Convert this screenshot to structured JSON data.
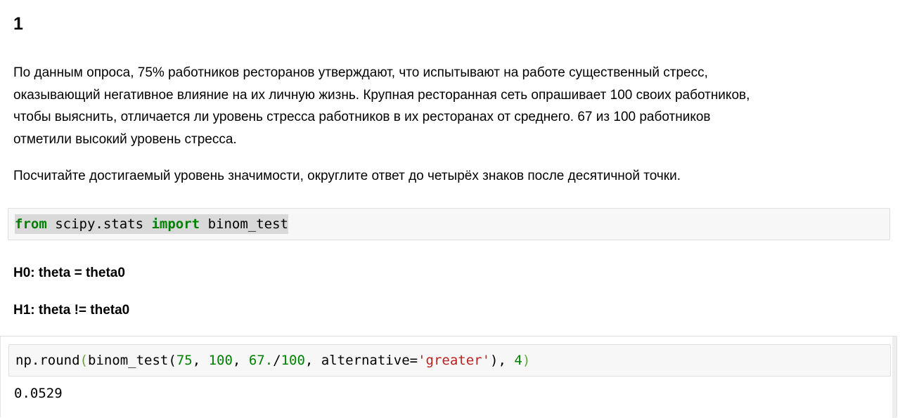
{
  "cell_heading": "1",
  "problem": {
    "lines": [
      "По данным опроса, 75% работников ресторанов утверждают, что испытывают на работе существенный стресс,",
      "оказывающий негативное влияние на их личную жизнь. Крупная ресторанная сеть опрашивает 100 своих работников,",
      "чтобы выяснить, отличается ли уровень стресса работников в их ресторанах от среднего. 67 из 100 работников",
      "отметили высокий уровень стресса."
    ],
    "task": "Посчитайте достигаемый уровень значимости, округлите ответ до четырёх знаков после десятичной точки."
  },
  "import_cell": {
    "kw_from": "from",
    "module": " scipy.stats ",
    "kw_import": "import",
    "name": " binom_test"
  },
  "hypotheses": {
    "h0": "H0: theta = theta0",
    "h1": "H1: theta != theta0"
  },
  "compute_cell": {
    "fn_round": "np.round",
    "open_outer": "(",
    "fn_test": "binom_test(",
    "arg1": "75",
    "sep1": ", ",
    "arg2": "100",
    "sep2": ", ",
    "arg3": "67.",
    "arg3_op": "/",
    "arg3_den": "100",
    "sep3": ", alternative=",
    "arg4": "'greater'",
    "close_inner": "), ",
    "arg5": "4",
    "close_outer": ")"
  },
  "output": {
    "value": "0.0529"
  },
  "colors": {
    "keyword": "#008000",
    "number": "#008000",
    "string": "#ba2121",
    "matched_paren": "#5fa63a",
    "code_background": "#f7f7f7"
  }
}
